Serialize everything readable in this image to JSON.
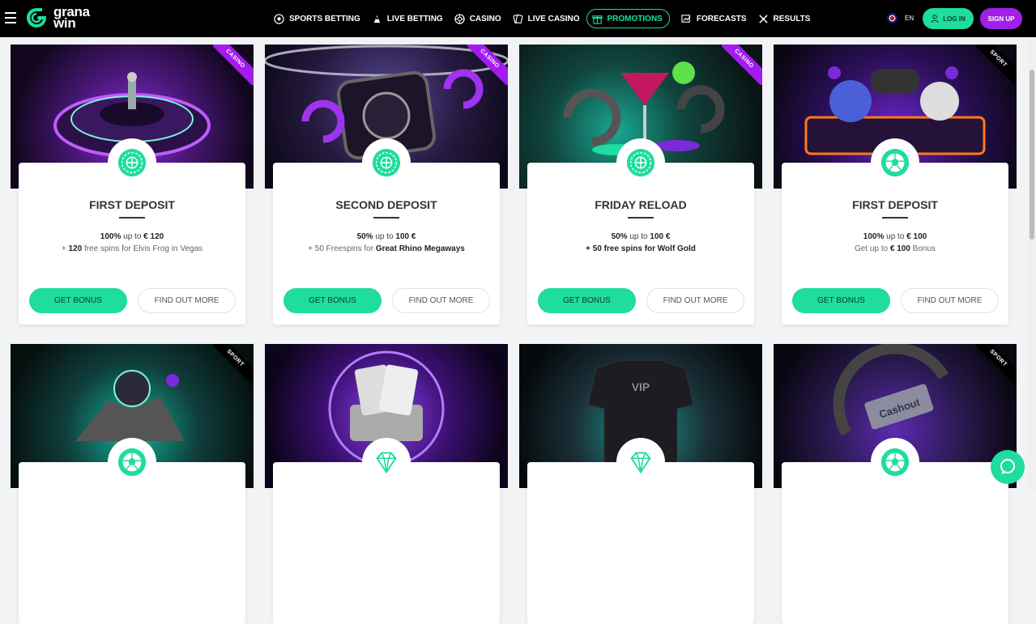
{
  "header": {
    "logo_line1": "grana",
    "logo_line2": "win",
    "nav": [
      {
        "label": "SPORTS BETTING",
        "icon": "soccer-ball-icon"
      },
      {
        "label": "LIVE BETTING",
        "icon": "live-icon"
      },
      {
        "label": "CASINO",
        "icon": "roulette-icon"
      },
      {
        "label": "LIVE CASINO",
        "icon": "cards-icon"
      },
      {
        "label": "PROMOTIONS",
        "icon": "gift-icon",
        "active": true
      },
      {
        "label": "FORECASTS",
        "icon": "chart-icon"
      },
      {
        "label": "RESULTS",
        "icon": "trophy-icon"
      }
    ],
    "language": "EN",
    "login_label": "LOG IN",
    "signup_label": "SIGN UP"
  },
  "colors": {
    "accent": "#1fdc9f",
    "brand_purple": "#a020e8"
  },
  "promos": [
    {
      "badge": "CASINO",
      "title": "FIRST DEPOSIT",
      "l1a": "100%",
      "l1b": " up to ",
      "l1c": "€ 120",
      "l2a": "+ ",
      "l2b": "120",
      "l2c": " free spins for Elvis Frog in Vegas",
      "icon": "roulette-wheel-icon",
      "bonus": "GET BONUS",
      "more": "FIND OUT MORE"
    },
    {
      "badge": "CASINO",
      "title": "SECOND DEPOSIT",
      "l1a": "50%",
      "l1b": " up to ",
      "l1c": "100 €",
      "l2a": "+ 50 Freespins for ",
      "l2b": "Great Rhino Megaways",
      "l2c": "",
      "icon": "roulette-wheel-icon",
      "bonus": "GET BONUS",
      "more": "FIND OUT MORE"
    },
    {
      "badge": "CASINO",
      "title": "FRIDAY RELOAD",
      "l1a": "50%",
      "l1b": " up to ",
      "l1c": "100 €",
      "l2a": "",
      "l2b": "+ 50 free spins for Wolf Gold",
      "l2c": "",
      "icon": "roulette-wheel-icon",
      "bonus": "GET BONUS",
      "more": "FIND OUT MORE"
    },
    {
      "badge": "SPORT",
      "title": "FIRST DEPOSIT",
      "l1a": "100%",
      "l1b": " up to ",
      "l1c": "€ 100",
      "l2a": "Get up to ",
      "l2b": "€ 100",
      "l2c": " Bonus",
      "icon": "soccer-ball-icon",
      "bonus": "GET BONUS",
      "more": "FIND OUT MORE"
    }
  ],
  "promos_row2": [
    {
      "badge": "SPORT",
      "icon": "soccer-ball-icon"
    },
    {
      "badge": "",
      "icon": "diamond-icon"
    },
    {
      "badge": "",
      "icon": "diamond-icon"
    },
    {
      "badge": "SPORT",
      "icon": "soccer-ball-icon"
    }
  ],
  "row2_art": {
    "vip_jersey": "VIP",
    "cashout_sign": "Cashout"
  }
}
